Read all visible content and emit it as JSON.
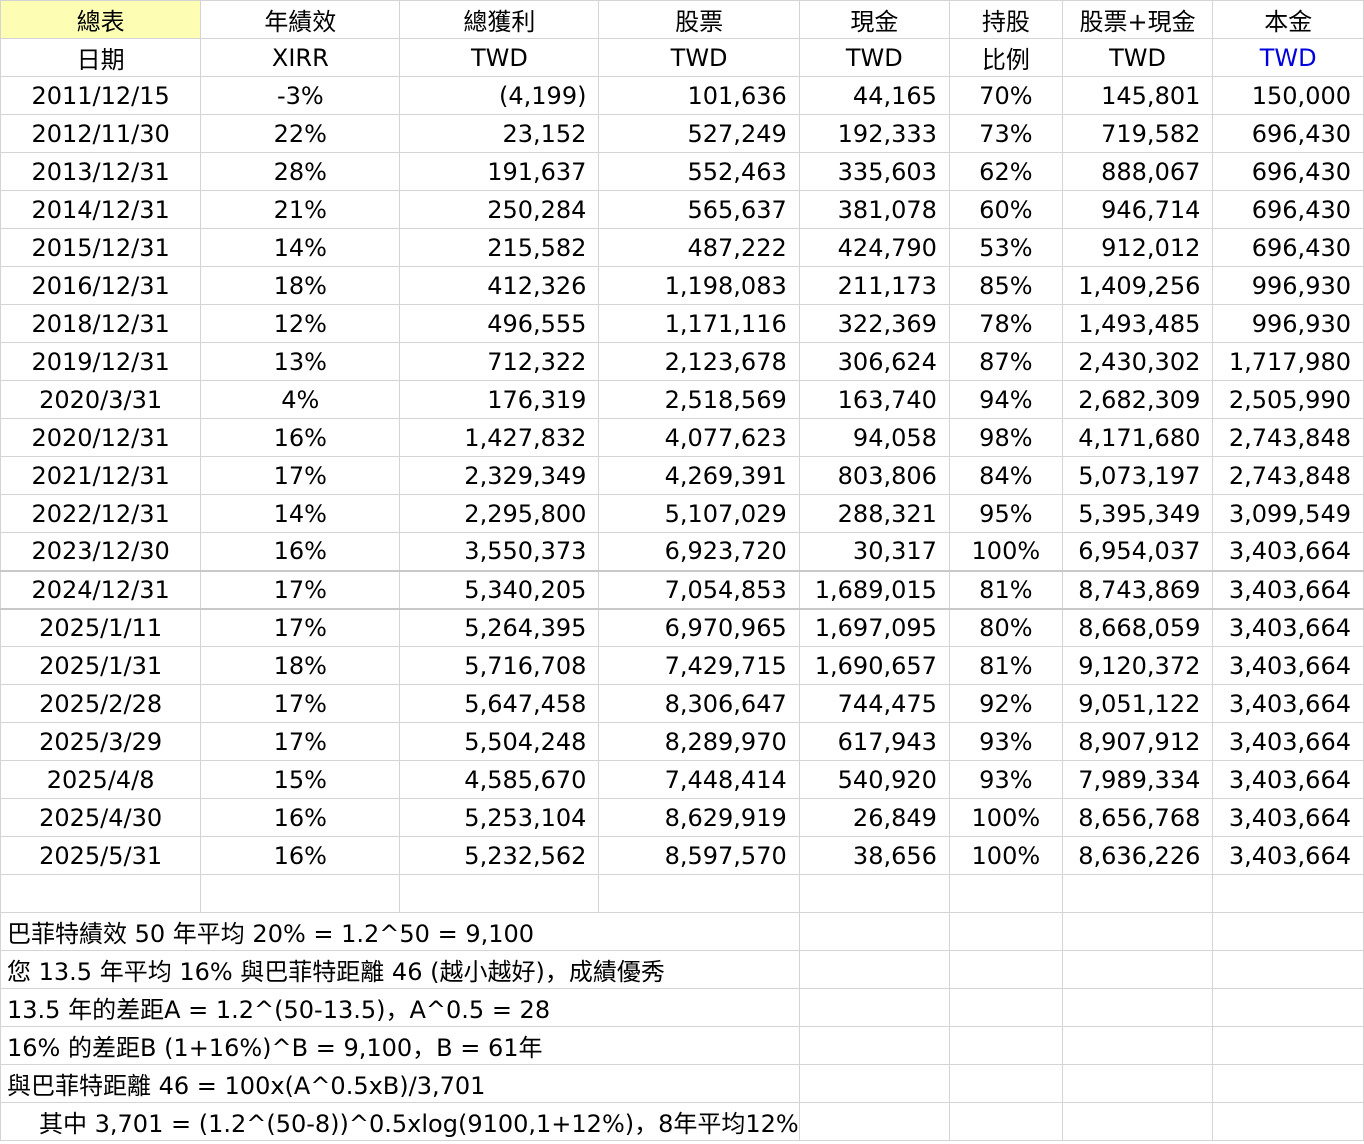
{
  "headers_row1": [
    "總表",
    "年績效",
    "總獲利",
    "股票",
    "現金",
    "持股",
    "股票+現金",
    "本金"
  ],
  "headers_row2": [
    "日期",
    "XIRR",
    "TWD",
    "TWD",
    "TWD",
    "比例",
    "TWD",
    "TWD"
  ],
  "rows": [
    [
      "2011/12/15",
      "-3%",
      "(4,199)",
      "101,636",
      "44,165",
      "70%",
      "145,801",
      "150,000"
    ],
    [
      "2012/11/30",
      "22%",
      "23,152",
      "527,249",
      "192,333",
      "73%",
      "719,582",
      "696,430"
    ],
    [
      "2013/12/31",
      "28%",
      "191,637",
      "552,463",
      "335,603",
      "62%",
      "888,067",
      "696,430"
    ],
    [
      "2014/12/31",
      "21%",
      "250,284",
      "565,637",
      "381,078",
      "60%",
      "946,714",
      "696,430"
    ],
    [
      "2015/12/31",
      "14%",
      "215,582",
      "487,222",
      "424,790",
      "53%",
      "912,012",
      "696,430"
    ],
    [
      "2016/12/31",
      "18%",
      "412,326",
      "1,198,083",
      "211,173",
      "85%",
      "1,409,256",
      "996,930"
    ],
    [
      "2018/12/31",
      "12%",
      "496,555",
      "1,171,116",
      "322,369",
      "78%",
      "1,493,485",
      "996,930"
    ],
    [
      "2019/12/31",
      "13%",
      "712,322",
      "2,123,678",
      "306,624",
      "87%",
      "2,430,302",
      "1,717,980"
    ],
    [
      "2020/3/31",
      "4%",
      "176,319",
      "2,518,569",
      "163,740",
      "94%",
      "2,682,309",
      "2,505,990"
    ],
    [
      "2020/12/31",
      "16%",
      "1,427,832",
      "4,077,623",
      "94,058",
      "98%",
      "4,171,680",
      "2,743,848"
    ],
    [
      "2021/12/31",
      "17%",
      "2,329,349",
      "4,269,391",
      "803,806",
      "84%",
      "5,073,197",
      "2,743,848"
    ],
    [
      "2022/12/31",
      "14%",
      "2,295,800",
      "5,107,029",
      "288,321",
      "95%",
      "5,395,349",
      "3,099,549"
    ],
    [
      "2023/12/30",
      "16%",
      "3,550,373",
      "6,923,720",
      "30,317",
      "100%",
      "6,954,037",
      "3,403,664"
    ],
    [
      "2024/12/31",
      "17%",
      "5,340,205",
      "7,054,853",
      "1,689,015",
      "81%",
      "8,743,869",
      "3,403,664"
    ],
    [
      "2025/1/11",
      "17%",
      "5,264,395",
      "6,970,965",
      "1,697,095",
      "80%",
      "8,668,059",
      "3,403,664"
    ],
    [
      "2025/1/31",
      "18%",
      "5,716,708",
      "7,429,715",
      "1,690,657",
      "81%",
      "9,120,372",
      "3,403,664"
    ],
    [
      "2025/2/28",
      "17%",
      "5,647,458",
      "8,306,647",
      "744,475",
      "92%",
      "9,051,122",
      "3,403,664"
    ],
    [
      "2025/3/29",
      "17%",
      "5,504,248",
      "8,289,970",
      "617,943",
      "93%",
      "8,907,912",
      "3,403,664"
    ],
    [
      "2025/4/8",
      "15%",
      "4,585,670",
      "7,448,414",
      "540,920",
      "93%",
      "7,989,334",
      "3,403,664"
    ],
    [
      "2025/4/30",
      "16%",
      "5,253,104",
      "8,629,919",
      "26,849",
      "100%",
      "8,656,768",
      "3,403,664"
    ],
    [
      "2025/5/31",
      "16%",
      "5,232,562",
      "8,597,570",
      "38,656",
      "100%",
      "8,636,226",
      "3,403,664"
    ]
  ],
  "notes": [
    "巴菲特績效 50 年平均 20% = 1.2^50 = 9,100",
    "您 13.5 年平均 16% 與巴菲特距離 46 (越小越好)，成績優秀",
    "13.5 年的差距A = 1.2^(50-13.5)，A^0.5 = 28",
    "16% 的差距B (1+16%)^B = 9,100，B = 61年",
    "與巴菲特距離 46 = 100x(A^0.5xB)/3,701",
    "其中 3,701 = (1.2^(50-8))^0.5xlog(9100,1+12%)，8年平均12%"
  ],
  "colors": {
    "title_highlight": "#fdfdb4",
    "twd_blue": "#0000dd",
    "gridline": "#d4d4d4"
  }
}
